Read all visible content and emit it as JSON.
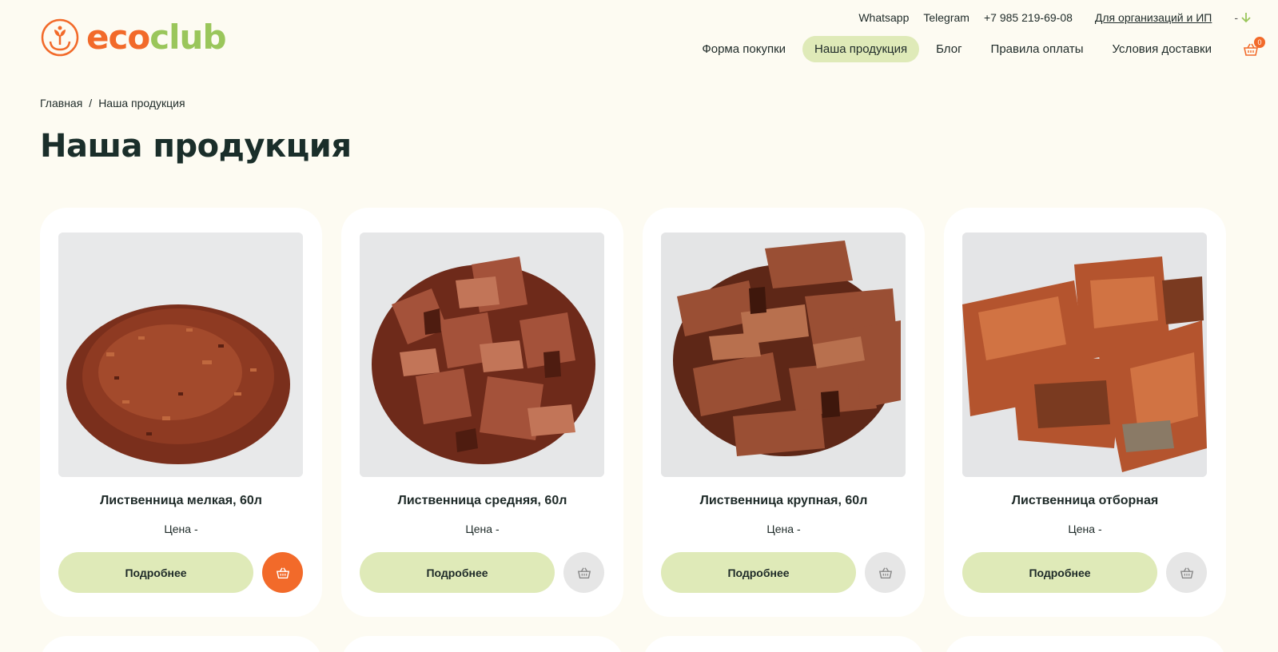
{
  "brand": {
    "eco": "eco",
    "club": "club",
    "color_primary": "#f26a2a",
    "color_secondary": "#9ac65b"
  },
  "topbar": {
    "whatsapp": "Whatsapp",
    "telegram": "Telegram",
    "phone": "+7 985 219-69-08",
    "org_link": "Для организаций и ИП",
    "lang": "-"
  },
  "nav": {
    "items": [
      {
        "label": "Форма покупки"
      },
      {
        "label": "Наша продукция"
      },
      {
        "label": "Блог"
      },
      {
        "label": "Правила оплаты"
      },
      {
        "label": "Условия доставки"
      }
    ],
    "cart_count": "0"
  },
  "breadcrumb": {
    "home": "Главная",
    "sep": "/",
    "current": "Наша продукция"
  },
  "page_title": "Наша продукция",
  "products": [
    {
      "title": "Лиственница мелкая, 60л",
      "price": "Цена -",
      "more_label": "Подробнее"
    },
    {
      "title": "Лиственница средняя, 60л",
      "price": "Цена -",
      "more_label": "Подробнее"
    },
    {
      "title": "Лиственница крупная, 60л",
      "price": "Цена -",
      "more_label": "Подробнее"
    },
    {
      "title": "Лиственница отборная",
      "price": "Цена -",
      "more_label": "Подробнее"
    }
  ]
}
